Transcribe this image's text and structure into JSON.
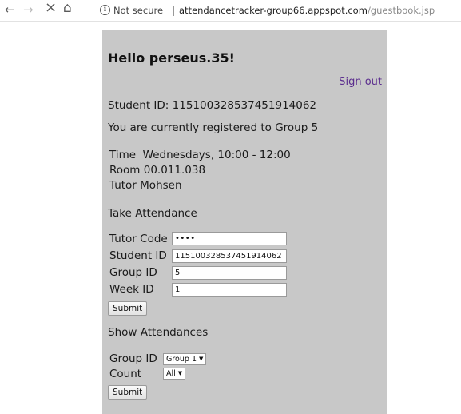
{
  "browser": {
    "back_icon": "←",
    "forward_icon": "→",
    "close_icon": "×",
    "home_icon": "⌂",
    "info_icon": "i",
    "secure_label": "Not secure",
    "url_host": "attendancetracker-group66.appspot.com",
    "url_path": "/guestbook.jsp"
  },
  "page": {
    "greeting": "Hello perseus.35!",
    "signout_label": "Sign out",
    "student_id_line": "Student ID: 115100328537451914062",
    "group_line": "You are currently registered to Group 5",
    "details": {
      "time_label": "Time",
      "time_value": "Wednesdays, 10:00 - 12:00",
      "room_label": "Room",
      "room_value": "00.011.038",
      "tutor_label": "Tutor",
      "tutor_value": "Mohsen"
    },
    "take_attendance": {
      "heading": "Take Attendance",
      "tutor_code_label": "Tutor Code",
      "tutor_code_value": "••••",
      "student_id_label": "Student ID",
      "student_id_value": "115100328537451914062",
      "group_id_label": "Group ID",
      "group_id_value": "5",
      "week_id_label": "Week ID",
      "week_id_value": "1",
      "submit_label": "Submit"
    },
    "show_attendances": {
      "heading": "Show Attendances",
      "group_id_label": "Group ID",
      "group_select_value": "Group 1",
      "count_label": "Count",
      "count_select_value": "All",
      "submit_label": "Submit"
    }
  },
  "colors": {
    "panel_bg": "#c8c8c8",
    "link": "#5b2d8e"
  }
}
